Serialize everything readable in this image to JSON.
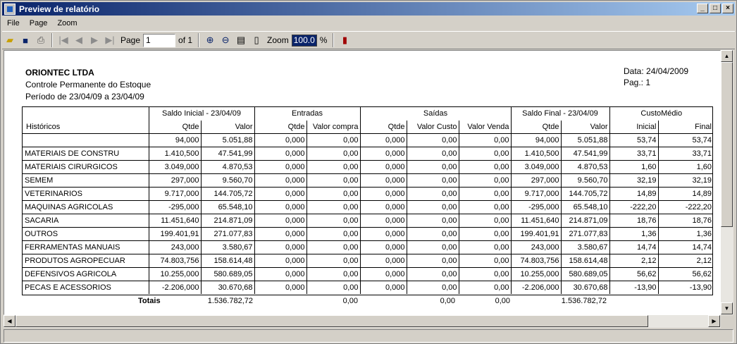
{
  "window": {
    "title": "Preview de relatório"
  },
  "menu": {
    "file": "File",
    "page": "Page",
    "zoom": "Zoom"
  },
  "toolbar": {
    "page_label": "Page",
    "page_value": "1",
    "of_label": "of 1",
    "zoom_label": "Zoom",
    "zoom_value": "100.0",
    "percent": "%"
  },
  "report": {
    "company": "ORIONTEC  LTDA",
    "subtitle": "Controle Permanente do Estoque",
    "period": "Período de 23/04/09  a  23/04/09",
    "date": "Data: 24/04/2009",
    "page": "Pag.: 1",
    "group_headers": [
      "Saldo Inicial - 23/04/09",
      "Entradas",
      "Saídas",
      "Saldo Final - 23/04/09",
      "CustoMédio"
    ],
    "column_headers": [
      "Históricos",
      "Qtde",
      "Valor",
      "Qtde",
      "Valor compra",
      "Qtde",
      "Valor Custo",
      "Valor Venda",
      "Qtde",
      "Valor",
      "Inicial",
      "Final"
    ],
    "rows": [
      [
        "",
        "94,000",
        "5.051,88",
        "0,000",
        "0,00",
        "0,000",
        "0,00",
        "0,00",
        "94,000",
        "5.051,88",
        "53,74",
        "53,74"
      ],
      [
        "MATERIAIS DE CONSTRU",
        "1.410,500",
        "47.541,99",
        "0,000",
        "0,00",
        "0,000",
        "0,00",
        "0,00",
        "1.410,500",
        "47.541,99",
        "33,71",
        "33,71"
      ],
      [
        "MATERIAIS  CIRURGICOS",
        "3.049,000",
        "4.870,53",
        "0,000",
        "0,00",
        "0,000",
        "0,00",
        "0,00",
        "3.049,000",
        "4.870,53",
        "1,60",
        "1,60"
      ],
      [
        "SEMEM",
        "297,000",
        "9.560,70",
        "0,000",
        "0,00",
        "0,000",
        "0,00",
        "0,00",
        "297,000",
        "9.560,70",
        "32,19",
        "32,19"
      ],
      [
        "VETERINARIOS",
        "9.717,000",
        "144.705,72",
        "0,000",
        "0,00",
        "0,000",
        "0,00",
        "0,00",
        "9.717,000",
        "144.705,72",
        "14,89",
        "14,89"
      ],
      [
        "MAQUINAS  AGRICOLAS",
        "-295,000",
        "65.548,10",
        "0,000",
        "0,00",
        "0,000",
        "0,00",
        "0,00",
        "-295,000",
        "65.548,10",
        "-222,20",
        "-222,20"
      ],
      [
        "SACARIA",
        "11.451,640",
        "214.871,09",
        "0,000",
        "0,00",
        "0,000",
        "0,00",
        "0,00",
        "11.451,640",
        "214.871,09",
        "18,76",
        "18,76"
      ],
      [
        "OUTROS",
        "199.401,91",
        "271.077,83",
        "0,000",
        "0,00",
        "0,000",
        "0,00",
        "0,00",
        "199.401,91",
        "271.077,83",
        "1,36",
        "1,36"
      ],
      [
        "FERRAMENTAS  MANUAIS",
        "243,000",
        "3.580,67",
        "0,000",
        "0,00",
        "0,000",
        "0,00",
        "0,00",
        "243,000",
        "3.580,67",
        "14,74",
        "14,74"
      ],
      [
        "PRODUTOS AGROPECUAR",
        "74.803,756",
        "158.614,48",
        "0,000",
        "0,00",
        "0,000",
        "0,00",
        "0,00",
        "74.803,756",
        "158.614,48",
        "2,12",
        "2,12"
      ],
      [
        "DEFENSIVOS  AGRICOLA",
        "10.255,000",
        "580.689,05",
        "0,000",
        "0,00",
        "0,000",
        "0,00",
        "0,00",
        "10.255,000",
        "580.689,05",
        "56,62",
        "56,62"
      ],
      [
        "PECAS E ACESSORIOS",
        "-2.206,000",
        "30.670,68",
        "0,000",
        "0,00",
        "0,000",
        "0,00",
        "0,00",
        "-2.206,000",
        "30.670,68",
        "-13,90",
        "-13,90"
      ]
    ],
    "totals": {
      "label": "Totais",
      "saldo_inicial_valor": "1.536.782,72",
      "entradas_valor": "0,00",
      "saidas_custo": "0,00",
      "saidas_venda": "0,00",
      "saldo_final_valor": "1.536.782,72"
    }
  }
}
